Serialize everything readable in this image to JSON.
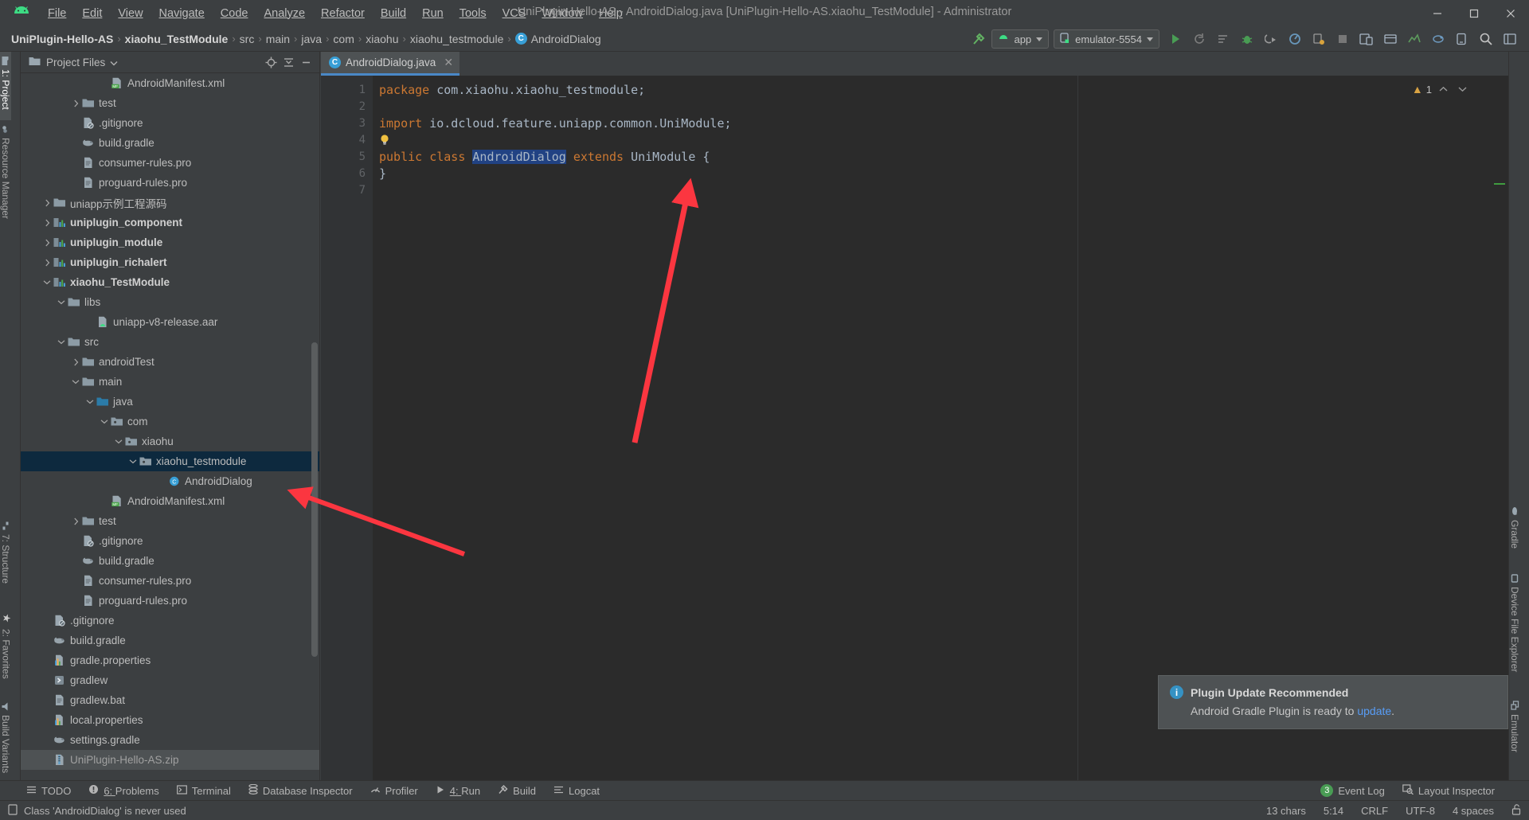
{
  "window": {
    "title": "UniPlugin-Hello-AS - AndroidDialog.java [UniPlugin-Hello-AS.xiaohu_TestModule] - Administrator",
    "logo": "android-logo",
    "minimize": "—",
    "maximize": "❐",
    "close": "✕"
  },
  "menu": {
    "items": [
      {
        "label": "File"
      },
      {
        "label": "Edit"
      },
      {
        "label": "View"
      },
      {
        "label": "Navigate"
      },
      {
        "label": "Code"
      },
      {
        "label": "Analyze"
      },
      {
        "label": "Refactor"
      },
      {
        "label": "Build"
      },
      {
        "label": "Run"
      },
      {
        "label": "Tools"
      },
      {
        "label": "VCS"
      },
      {
        "label": "Window"
      },
      {
        "label": "Help"
      }
    ]
  },
  "breadcrumb": {
    "items": [
      {
        "label": "UniPlugin-Hello-AS",
        "bold": true
      },
      {
        "label": "xiaohu_TestModule",
        "bold": true
      },
      {
        "label": "src",
        "bold": false
      },
      {
        "label": "main",
        "bold": false
      },
      {
        "label": "java",
        "bold": false
      },
      {
        "label": "com",
        "bold": false
      },
      {
        "label": "xiaohu",
        "bold": false
      },
      {
        "label": "xiaohu_testmodule",
        "bold": false
      },
      {
        "label": "AndroidDialog",
        "bold": false,
        "icon": "class-icon"
      }
    ],
    "separator": "›"
  },
  "toolbar": {
    "build_icon": "hammer-icon",
    "app_config": "app",
    "device": "emulator-5554",
    "run_icon": "run-icon",
    "apply_changes_icon": "apply-changes-icon",
    "apply_code_changes_icon": "apply-code-changes-icon",
    "debug_icon": "debug-icon",
    "attach_debugger_icon": "attach-debugger-icon",
    "profile_icon": "profile-icon",
    "profiler_icon": "profiler-icon",
    "stop_icon": "stop-icon",
    "avd_manager_icon": "avd-manager-icon",
    "sdk_manager_icon": "sdk-manager-icon",
    "layout_editor_icon": "layout-editor-icon",
    "sync_gradle_icon": "sync-gradle-icon",
    "search_icon": "search-icon",
    "project_structure_icon": "project-structure-icon"
  },
  "left_strip": {
    "tabs": [
      {
        "label": "1: Project",
        "icon": "project-icon",
        "selected": true
      },
      {
        "label": "Resource Manager",
        "icon": "resource-manager-icon",
        "selected": false
      },
      {
        "label": "7: Structure",
        "icon": "structure-icon",
        "selected": false
      },
      {
        "label": "2: Favorites",
        "icon": "star-icon",
        "selected": false
      },
      {
        "label": "Build Variants",
        "icon": "build-variants-icon",
        "selected": false
      }
    ]
  },
  "right_strip": {
    "tabs": [
      {
        "label": "Gradle",
        "icon": "gradle-icon"
      },
      {
        "label": "Device File Explorer",
        "icon": "device-file-explorer-icon"
      },
      {
        "label": "Emulator",
        "icon": "emulator-icon"
      }
    ]
  },
  "project_panel": {
    "title": "Project Files",
    "title_icon": "folder-icon",
    "dropdown_icon": "chevron-down-icon",
    "locate_icon": "locate-icon",
    "collapse_icon": "collapse-all-icon",
    "hide_icon": "hide-icon",
    "tree": [
      {
        "indent": 5,
        "arrow": "",
        "icon": "manifest-icon",
        "label": "AndroidManifest.xml",
        "bold": false,
        "state": ""
      },
      {
        "indent": 3,
        "arrow": "›",
        "icon": "folder-icon",
        "label": "test",
        "bold": false,
        "state": ""
      },
      {
        "indent": 3,
        "arrow": "",
        "icon": "gitignore-icon",
        "label": ".gitignore",
        "bold": false,
        "state": ""
      },
      {
        "indent": 3,
        "arrow": "",
        "icon": "gradle-file-icon",
        "label": "build.gradle",
        "bold": false,
        "state": ""
      },
      {
        "indent": 3,
        "arrow": "",
        "icon": "pro-file-icon",
        "label": "consumer-rules.pro",
        "bold": false,
        "state": ""
      },
      {
        "indent": 3,
        "arrow": "",
        "icon": "pro-file-icon",
        "label": "proguard-rules.pro",
        "bold": false,
        "state": ""
      },
      {
        "indent": 1,
        "arrow": "›",
        "icon": "folder-icon",
        "label": "uniapp示例工程源码",
        "bold": false,
        "state": ""
      },
      {
        "indent": 1,
        "arrow": "›",
        "icon": "module-icon",
        "label": "uniplugin_component",
        "bold": true,
        "state": ""
      },
      {
        "indent": 1,
        "arrow": "›",
        "icon": "module-icon",
        "label": "uniplugin_module",
        "bold": true,
        "state": ""
      },
      {
        "indent": 1,
        "arrow": "›",
        "icon": "module-icon",
        "label": "uniplugin_richalert",
        "bold": true,
        "state": ""
      },
      {
        "indent": 1,
        "arrow": "⌄",
        "icon": "module-icon",
        "label": "xiaohu_TestModule",
        "bold": true,
        "state": ""
      },
      {
        "indent": 2,
        "arrow": "⌄",
        "icon": "folder-icon",
        "label": "libs",
        "bold": false,
        "state": ""
      },
      {
        "indent": 4,
        "arrow": "",
        "icon": "aar-icon",
        "label": "uniapp-v8-release.aar",
        "bold": false,
        "state": ""
      },
      {
        "indent": 2,
        "arrow": "⌄",
        "icon": "folder-icon",
        "label": "src",
        "bold": false,
        "state": ""
      },
      {
        "indent": 3,
        "arrow": "›",
        "icon": "folder-icon",
        "label": "androidTest",
        "bold": false,
        "state": ""
      },
      {
        "indent": 3,
        "arrow": "⌄",
        "icon": "folder-icon",
        "label": "main",
        "bold": false,
        "state": ""
      },
      {
        "indent": 4,
        "arrow": "⌄",
        "icon": "source-folder-icon",
        "label": "java",
        "bold": false,
        "state": ""
      },
      {
        "indent": 5,
        "arrow": "⌄",
        "icon": "package-icon",
        "label": "com",
        "bold": false,
        "state": ""
      },
      {
        "indent": 6,
        "arrow": "⌄",
        "icon": "package-icon",
        "label": "xiaohu",
        "bold": false,
        "state": ""
      },
      {
        "indent": 7,
        "arrow": "⌄",
        "icon": "package-icon",
        "label": "xiaohu_testmodule",
        "bold": false,
        "state": "selected"
      },
      {
        "indent": 9,
        "arrow": "",
        "icon": "class-icon",
        "label": "AndroidDialog",
        "bold": false,
        "state": ""
      },
      {
        "indent": 5,
        "arrow": "",
        "icon": "manifest-icon",
        "label": "AndroidManifest.xml",
        "bold": false,
        "state": ""
      },
      {
        "indent": 3,
        "arrow": "›",
        "icon": "folder-icon",
        "label": "test",
        "bold": false,
        "state": ""
      },
      {
        "indent": 3,
        "arrow": "",
        "icon": "gitignore-icon",
        "label": ".gitignore",
        "bold": false,
        "state": ""
      },
      {
        "indent": 3,
        "arrow": "",
        "icon": "gradle-file-icon",
        "label": "build.gradle",
        "bold": false,
        "state": ""
      },
      {
        "indent": 3,
        "arrow": "",
        "icon": "pro-file-icon",
        "label": "consumer-rules.pro",
        "bold": false,
        "state": ""
      },
      {
        "indent": 3,
        "arrow": "",
        "icon": "pro-file-icon",
        "label": "proguard-rules.pro",
        "bold": false,
        "state": ""
      },
      {
        "indent": 1,
        "arrow": "",
        "icon": "gitignore-icon",
        "label": ".gitignore",
        "bold": false,
        "state": ""
      },
      {
        "indent": 1,
        "arrow": "",
        "icon": "gradle-file-icon",
        "label": "build.gradle",
        "bold": false,
        "state": ""
      },
      {
        "indent": 1,
        "arrow": "",
        "icon": "properties-icon",
        "label": "gradle.properties",
        "bold": false,
        "state": ""
      },
      {
        "indent": 1,
        "arrow": "",
        "icon": "script-icon",
        "label": "gradlew",
        "bold": false,
        "state": ""
      },
      {
        "indent": 1,
        "arrow": "",
        "icon": "bat-icon",
        "label": "gradlew.bat",
        "bold": false,
        "state": ""
      },
      {
        "indent": 1,
        "arrow": "",
        "icon": "properties-icon",
        "label": "local.properties",
        "bold": false,
        "state": ""
      },
      {
        "indent": 1,
        "arrow": "",
        "icon": "gradle-file-icon",
        "label": "settings.gradle",
        "bold": false,
        "state": ""
      },
      {
        "indent": 1,
        "arrow": "",
        "icon": "zip-icon",
        "label": "UniPlugin-Hello-AS.zip",
        "bold": false,
        "state": "highlight"
      }
    ]
  },
  "editor": {
    "tab": {
      "label": "AndroidDialog.java",
      "icon": "class-icon",
      "close": "✕"
    },
    "warning_count": "1",
    "warning_icon": "warning-triangle-icon",
    "up_icon": "chevron-up-icon",
    "down_icon": "chevron-down-icon",
    "line_numbers": [
      "1",
      "2",
      "3",
      "4",
      "5",
      "6",
      "7"
    ],
    "lines": [
      {
        "n": 1,
        "segments": [
          {
            "t": "package",
            "c": "kw"
          },
          {
            "t": " com.xiaohu.xiaohu_testmodule;",
            "c": ""
          }
        ]
      },
      {
        "n": 2,
        "segments": []
      },
      {
        "n": 3,
        "segments": [
          {
            "t": "import",
            "c": "kw"
          },
          {
            "t": " io.dcloud.feature.uniapp.common.UniModule;",
            "c": ""
          }
        ]
      },
      {
        "n": 4,
        "segments": [
          {
            "t": "",
            "c": "bulb"
          }
        ]
      },
      {
        "n": 5,
        "segments": [
          {
            "t": "public",
            "c": "kw"
          },
          {
            "t": " ",
            "c": ""
          },
          {
            "t": "class",
            "c": "kw"
          },
          {
            "t": " ",
            "c": ""
          },
          {
            "t": "AndroidDialog",
            "c": "sel-ident"
          },
          {
            "t": " ",
            "c": ""
          },
          {
            "t": "extends",
            "c": "kw"
          },
          {
            "t": " UniModule {",
            "c": ""
          }
        ]
      },
      {
        "n": 6,
        "segments": [
          {
            "t": "}",
            "c": ""
          }
        ]
      },
      {
        "n": 7,
        "segments": []
      }
    ]
  },
  "notification": {
    "icon": "info-icon",
    "title": "Plugin Update Recommended",
    "body_prefix": "Android Gradle Plugin is ready to ",
    "link": "update",
    "body_suffix": "."
  },
  "bottom_tools": {
    "items": [
      {
        "label": "TODO",
        "icon": "todo-icon",
        "prefix": ""
      },
      {
        "label": "Problems",
        "icon": "problems-icon",
        "prefix": "6: "
      },
      {
        "label": "Terminal",
        "icon": "terminal-icon",
        "prefix": ""
      },
      {
        "label": "Database Inspector",
        "icon": "database-icon",
        "prefix": ""
      },
      {
        "label": "Profiler",
        "icon": "profiler-icon",
        "prefix": ""
      },
      {
        "label": "Run",
        "icon": "run-icon",
        "prefix": "4: "
      },
      {
        "label": "Build",
        "icon": "build-hammer-icon",
        "prefix": ""
      },
      {
        "label": "Logcat",
        "icon": "logcat-icon",
        "prefix": ""
      }
    ],
    "right": [
      {
        "label": "Event Log",
        "icon": "event-log-icon",
        "badge": "3"
      },
      {
        "label": "Layout Inspector",
        "icon": "layout-inspector-icon",
        "badge": ""
      }
    ]
  },
  "status_bar": {
    "icon": "status-doc-icon",
    "message": "Class 'AndroidDialog' is never used",
    "chars": "13 chars",
    "caret": "5:14",
    "line_sep": "CRLF",
    "encoding": "UTF-8",
    "indent": "4 spaces",
    "lock_icon": "unlocked-icon"
  },
  "colors": {
    "accent_blue": "#4a88c7",
    "selection": "#0d293e",
    "keyword_orange": "#cc7832",
    "editor_bg": "#2b2b2b",
    "panel_bg": "#3c3f41",
    "annotation_red": "#fb3640",
    "link_blue": "#589df6",
    "green": "#499c54"
  }
}
